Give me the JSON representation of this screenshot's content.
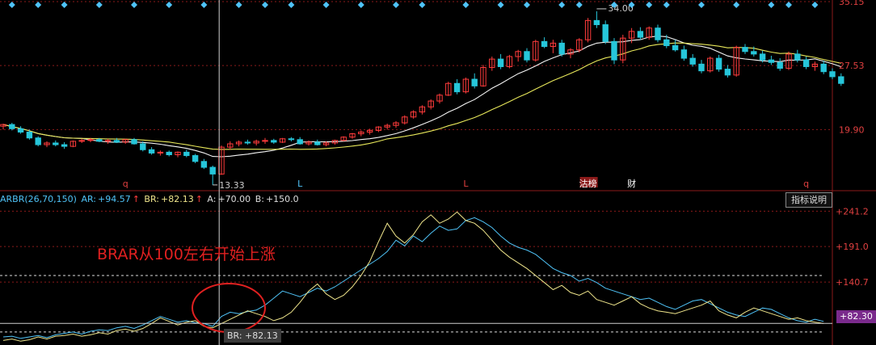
{
  "chart_data": [
    {
      "type": "candlestick",
      "y_axis_ticks": [
        "35.15",
        "27.53",
        "19.90"
      ],
      "ylim": [
        13.0,
        35.15
      ],
      "annotations": {
        "high": "34.00",
        "low": "13.33"
      },
      "markers": [
        {
          "label": "q",
          "index": 14,
          "color": "#e04040"
        },
        {
          "label": "L",
          "index": 34,
          "color": "#4fc3f7"
        },
        {
          "label": "L",
          "index": 53,
          "color": "#e04040"
        },
        {
          "label": "沽榜",
          "index": 67,
          "color": "#ffffff",
          "bg": "#8b1a1a"
        },
        {
          "label": "财",
          "index": 72,
          "color": "#ffffff"
        },
        {
          "label": "q",
          "index": 92,
          "color": "#e04040"
        }
      ],
      "candles": [
        [
          20.3,
          20.6,
          19.9,
          20.5
        ],
        [
          20.5,
          20.7,
          19.8,
          20.0
        ],
        [
          20.0,
          20.3,
          19.4,
          19.6
        ],
        [
          19.6,
          19.9,
          18.7,
          18.9
        ],
        [
          18.9,
          19.1,
          17.9,
          18.1
        ],
        [
          18.1,
          18.5,
          17.8,
          18.3
        ],
        [
          18.3,
          18.6,
          17.9,
          18.1
        ],
        [
          18.1,
          18.4,
          17.6,
          17.9
        ],
        [
          17.9,
          18.6,
          17.8,
          18.5
        ],
        [
          18.5,
          18.8,
          18.3,
          18.6
        ],
        [
          18.6,
          18.9,
          18.4,
          18.7
        ],
        [
          18.7,
          18.9,
          18.4,
          18.5
        ],
        [
          18.5,
          18.8,
          18.2,
          18.6
        ],
        [
          18.6,
          18.9,
          18.3,
          18.4
        ],
        [
          18.4,
          18.8,
          18.2,
          18.7
        ],
        [
          18.7,
          18.9,
          18.1,
          18.2
        ],
        [
          18.2,
          18.5,
          17.3,
          17.5
        ],
        [
          17.5,
          17.8,
          16.9,
          17.1
        ],
        [
          17.1,
          17.4,
          16.8,
          17.2
        ],
        [
          17.2,
          17.4,
          16.7,
          16.9
        ],
        [
          16.9,
          17.3,
          16.6,
          17.2
        ],
        [
          17.2,
          17.5,
          16.6,
          16.8
        ],
        [
          16.8,
          17.0,
          15.9,
          16.1
        ],
        [
          16.1,
          16.4,
          15.2,
          15.4
        ],
        [
          15.4,
          15.6,
          13.3,
          14.6
        ],
        [
          14.6,
          18.0,
          14.5,
          17.8
        ],
        [
          17.8,
          18.5,
          17.5,
          18.2
        ],
        [
          18.2,
          18.6,
          17.9,
          18.4
        ],
        [
          18.4,
          18.7,
          18.1,
          18.3
        ],
        [
          18.3,
          18.7,
          18.0,
          18.5
        ],
        [
          18.5,
          18.9,
          18.2,
          18.6
        ],
        [
          18.6,
          18.8,
          18.2,
          18.4
        ],
        [
          18.4,
          18.9,
          18.3,
          18.8
        ],
        [
          18.8,
          19.0,
          18.5,
          18.7
        ],
        [
          18.7,
          19.0,
          18.1,
          18.2
        ],
        [
          18.2,
          18.6,
          18.0,
          18.4
        ],
        [
          18.4,
          18.7,
          18.0,
          18.1
        ],
        [
          18.1,
          18.5,
          17.9,
          18.3
        ],
        [
          18.3,
          18.7,
          18.1,
          18.6
        ],
        [
          18.6,
          19.1,
          18.5,
          19.0
        ],
        [
          19.0,
          19.5,
          18.8,
          19.4
        ],
        [
          19.4,
          19.8,
          19.1,
          19.6
        ],
        [
          19.6,
          20.0,
          19.3,
          19.8
        ],
        [
          19.8,
          20.3,
          19.6,
          20.2
        ],
        [
          20.2,
          20.6,
          19.9,
          20.4
        ],
        [
          20.4,
          20.9,
          20.1,
          20.7
        ],
        [
          20.7,
          21.6,
          20.5,
          21.4
        ],
        [
          21.4,
          22.2,
          21.2,
          22.0
        ],
        [
          22.0,
          22.8,
          21.7,
          22.6
        ],
        [
          22.6,
          23.5,
          22.3,
          23.3
        ],
        [
          23.3,
          24.2,
          23.0,
          24.0
        ],
        [
          24.0,
          25.6,
          23.9,
          25.4
        ],
        [
          25.4,
          25.9,
          24.1,
          24.4
        ],
        [
          24.4,
          26.1,
          24.2,
          25.9
        ],
        [
          25.9,
          26.6,
          24.8,
          25.1
        ],
        [
          25.1,
          27.6,
          25.0,
          27.3
        ],
        [
          27.3,
          28.6,
          26.9,
          28.3
        ],
        [
          28.3,
          28.9,
          27.1,
          27.4
        ],
        [
          27.4,
          28.8,
          27.2,
          28.6
        ],
        [
          28.6,
          29.4,
          28.0,
          29.2
        ],
        [
          29.2,
          29.6,
          27.9,
          28.2
        ],
        [
          28.2,
          30.6,
          28.0,
          30.4
        ],
        [
          30.4,
          30.9,
          29.6,
          29.8
        ],
        [
          29.8,
          30.6,
          29.0,
          30.2
        ],
        [
          30.2,
          30.6,
          28.6,
          28.9
        ],
        [
          28.9,
          29.6,
          28.4,
          29.4
        ],
        [
          29.4,
          30.8,
          29.1,
          30.6
        ],
        [
          30.6,
          33.2,
          30.3,
          32.9
        ],
        [
          32.9,
          34.0,
          32.0,
          32.4
        ],
        [
          32.4,
          32.9,
          30.1,
          30.4
        ],
        [
          30.4,
          30.8,
          27.7,
          28.2
        ],
        [
          28.2,
          31.2,
          27.8,
          30.8
        ],
        [
          30.8,
          32.0,
          30.2,
          31.6
        ],
        [
          31.6,
          32.1,
          30.6,
          30.9
        ],
        [
          30.9,
          32.2,
          30.6,
          32.0
        ],
        [
          32.0,
          32.4,
          30.3,
          30.6
        ],
        [
          30.6,
          31.2,
          29.6,
          29.9
        ],
        [
          29.9,
          30.6,
          29.2,
          29.4
        ],
        [
          29.4,
          29.9,
          28.1,
          28.4
        ],
        [
          28.4,
          28.9,
          27.4,
          27.7
        ],
        [
          27.7,
          28.2,
          26.6,
          26.9
        ],
        [
          26.9,
          28.6,
          26.7,
          28.4
        ],
        [
          28.4,
          28.8,
          26.8,
          27.1
        ],
        [
          27.1,
          27.6,
          26.1,
          26.4
        ],
        [
          26.4,
          29.9,
          26.2,
          29.7
        ],
        [
          29.7,
          30.1,
          28.9,
          29.2
        ],
        [
          29.2,
          29.8,
          28.6,
          28.9
        ],
        [
          28.9,
          29.3,
          27.9,
          28.2
        ],
        [
          28.2,
          28.7,
          27.6,
          27.9
        ],
        [
          27.9,
          28.4,
          26.9,
          27.2
        ],
        [
          27.2,
          29.2,
          27.0,
          28.9
        ],
        [
          28.9,
          29.4,
          27.9,
          28.2
        ],
        [
          28.2,
          28.6,
          27.1,
          27.4
        ],
        [
          27.4,
          28.0,
          26.9,
          27.7
        ],
        [
          27.7,
          28.1,
          26.5,
          26.8
        ],
        [
          26.8,
          27.2,
          25.9,
          26.2
        ],
        [
          26.2,
          26.6,
          25.1,
          25.4
        ]
      ]
    },
    {
      "type": "line",
      "header": {
        "name": "ARBR(26,70,150)",
        "ar_label": "AR:",
        "ar_value": "+94.57",
        "ar_arrow": "↑",
        "br_label": "BR:",
        "br_value": "+82.13",
        "br_arrow": "↑",
        "a_label": "A:",
        "a_value": "+70.00",
        "b_label": "B:",
        "b_value": "+150.0"
      },
      "y_axis_ticks": [
        "+241.2",
        "+191.0",
        "+140.7",
        "+82.30"
      ],
      "ylim": [
        55,
        245
      ],
      "reference_lines": [
        70,
        150
      ],
      "series": [
        {
          "name": "AR",
          "color": "#4fc3f7",
          "values": [
            63,
            64,
            61,
            63,
            65,
            62,
            66,
            68,
            70,
            67,
            71,
            73,
            72,
            76,
            78,
            75,
            80,
            86,
            92,
            88,
            84,
            86,
            83,
            82,
            78,
            92,
            98,
            96,
            99,
            101,
            108,
            118,
            128,
            124,
            120,
            126,
            132,
            128,
            134,
            142,
            150,
            158,
            166,
            174,
            184,
            200,
            192,
            206,
            198,
            210,
            220,
            214,
            216,
            228,
            232,
            226,
            218,
            206,
            196,
            190,
            186,
            180,
            170,
            160,
            154,
            150,
            142,
            146,
            140,
            132,
            128,
            124,
            120,
            116,
            118,
            112,
            106,
            102,
            108,
            114,
            116,
            110,
            104,
            98,
            94,
            92,
            98,
            104,
            102,
            96,
            90,
            86,
            84,
            88,
            85
          ]
        },
        {
          "name": "BR",
          "color": "#f0e68c",
          "values": [
            58,
            60,
            57,
            59,
            63,
            60,
            64,
            65,
            67,
            64,
            66,
            69,
            67,
            72,
            74,
            71,
            75,
            82,
            90,
            85,
            80,
            84,
            86,
            78,
            76,
            82,
            88,
            94,
            100,
            96,
            92,
            86,
            90,
            98,
            112,
            128,
            138,
            124,
            116,
            122,
            134,
            150,
            170,
            198,
            224,
            206,
            196,
            208,
            226,
            236,
            224,
            230,
            240,
            228,
            224,
            214,
            200,
            186,
            176,
            168,
            160,
            150,
            140,
            130,
            136,
            126,
            122,
            128,
            116,
            112,
            108,
            114,
            120,
            110,
            104,
            100,
            98,
            96,
            100,
            104,
            108,
            114,
            100,
            94,
            90,
            98,
            104,
            100,
            96,
            92,
            88,
            90,
            86,
            84,
            82
          ]
        }
      ]
    }
  ],
  "annotation": {
    "text": "BRAR从100左右开始上涨"
  },
  "br_tag": "BR: +82.13",
  "help_button": "指标说明",
  "colors": {
    "up": "#ff3b3b",
    "down": "#26c6da",
    "ma_white": "#f5f5f5",
    "ma_yellow": "#e8e85a",
    "grid": "#8b1a1a",
    "crosshair": "#cfcfcf"
  }
}
